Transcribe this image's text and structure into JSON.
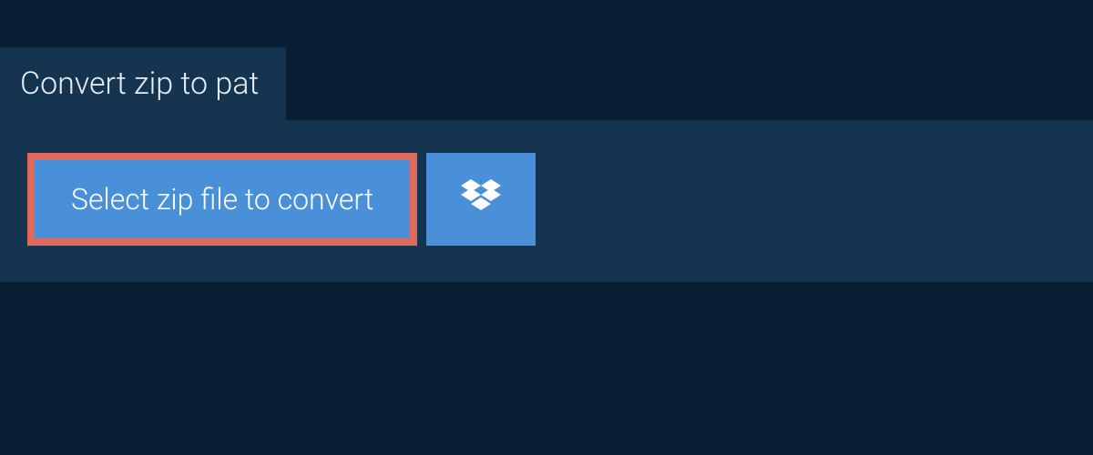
{
  "header": {
    "title": "Convert zip to pat"
  },
  "actions": {
    "select_file_label": "Select zip file to convert"
  }
}
